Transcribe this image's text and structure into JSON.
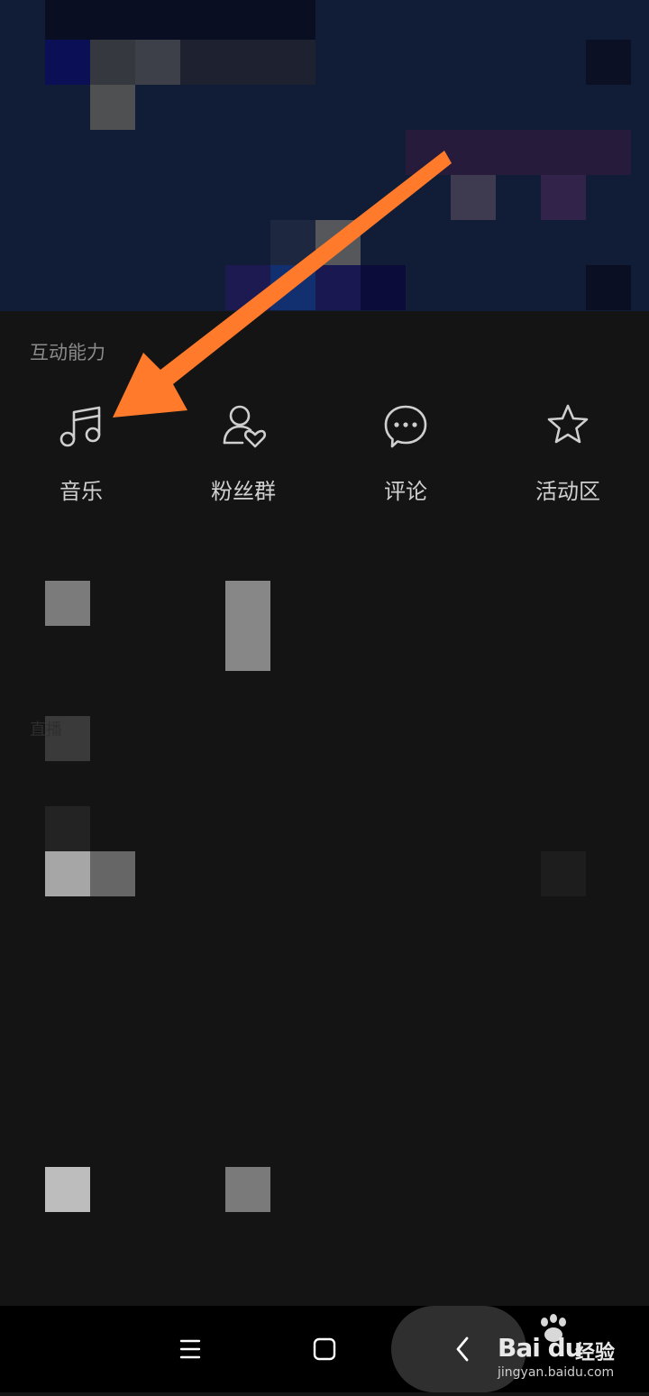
{
  "section": {
    "title": "互动能力"
  },
  "features": [
    {
      "label": "音乐",
      "icon": "music-note-icon"
    },
    {
      "label": "粉丝群",
      "icon": "fan-group-icon"
    },
    {
      "label": "评论",
      "icon": "comment-bubble-icon"
    },
    {
      "label": "活动区",
      "icon": "star-icon"
    }
  ],
  "faint_text": "直播",
  "navbar": {
    "icons": [
      "menu-icon",
      "home-square-icon",
      "back-chevron-icon"
    ]
  },
  "watermark": {
    "brand": "Bai du",
    "name": "经验",
    "url": "jingyan.baidu.com"
  },
  "colors": {
    "arrow": "#ff7a2a",
    "sheet_bg": "#141414",
    "label": "#d0d0d0",
    "section_title": "#8a8a8a"
  }
}
